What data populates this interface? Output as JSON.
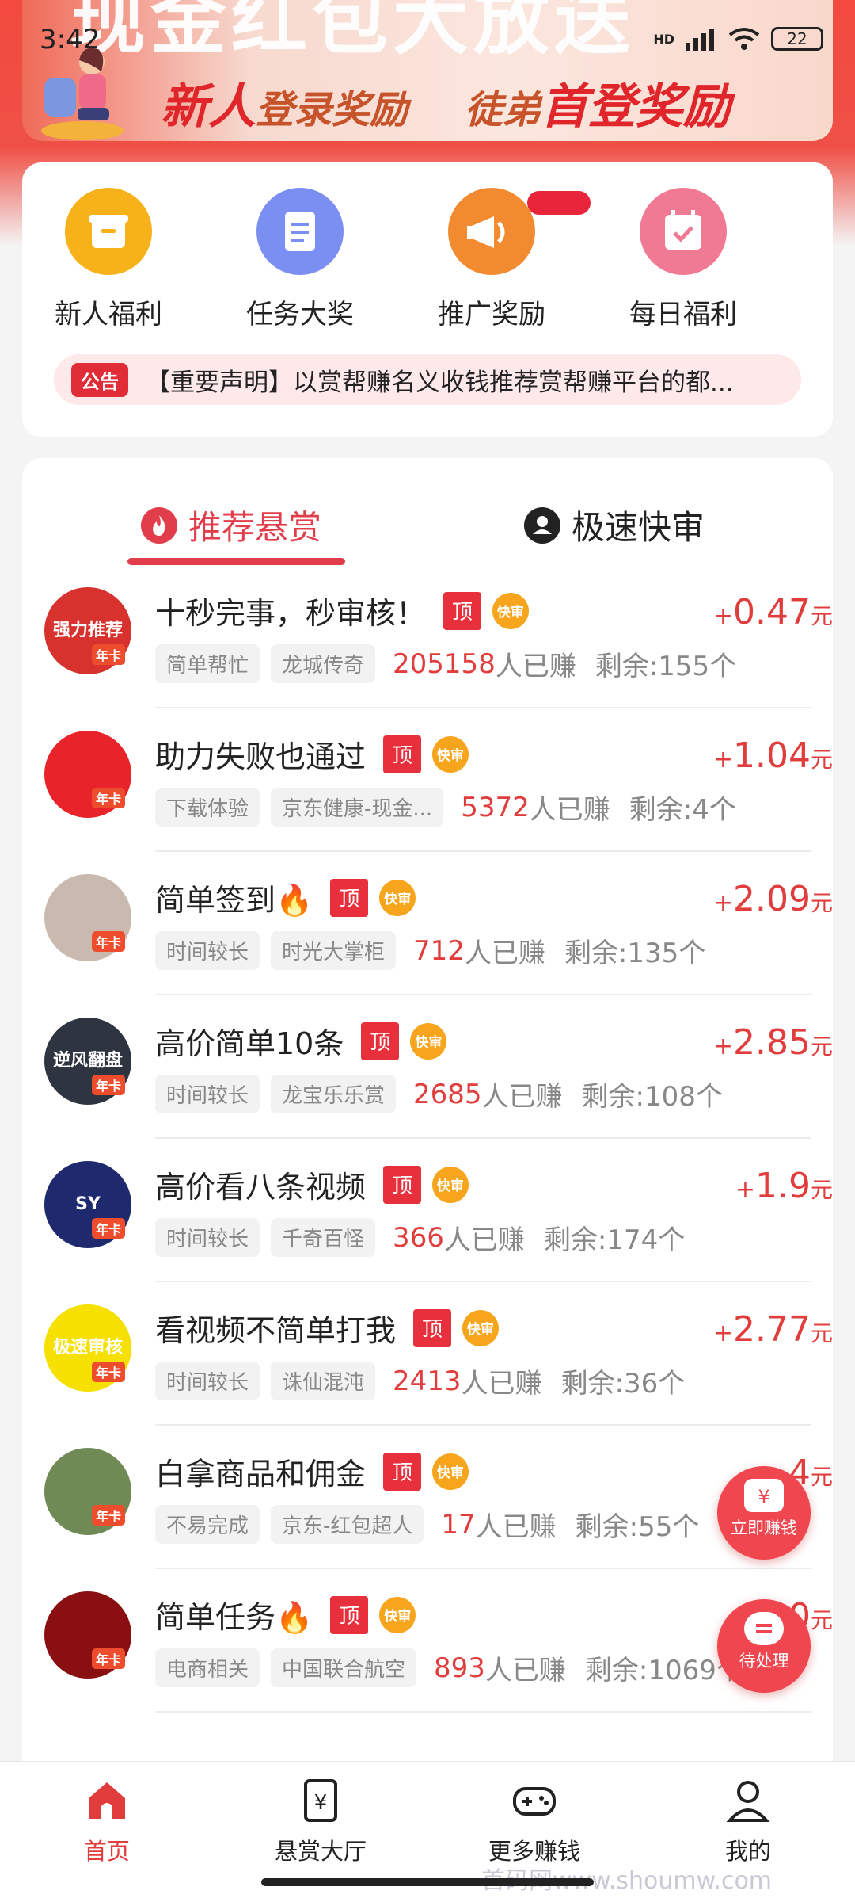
{
  "status_bar": {
    "time": "3:42",
    "network": "HD",
    "battery": "22"
  },
  "banner": {
    "headline": "现金红包大放送",
    "sub_part1": "新人",
    "sub_part2": "登录奖励",
    "sub_part3": "徒弟",
    "sub_part4": "首登奖励"
  },
  "quick_menu": [
    {
      "label": "新人福利",
      "icon": "gift-box-icon",
      "color": "#f7b21a"
    },
    {
      "label": "任务大奖",
      "icon": "clipboard-icon",
      "color": "#7b8ef2"
    },
    {
      "label": "推广奖励",
      "icon": "megaphone-icon",
      "color": "#f28a30"
    },
    {
      "label": "每日福利",
      "icon": "calendar-check-icon",
      "color": "#f07a93"
    }
  ],
  "notice": {
    "tag": "公告",
    "text": "【重要声明】以赏帮赚名义收钱推荐赏帮赚平台的都..."
  },
  "tabs": {
    "recommended": "推荐悬赏",
    "fast_review": "极速快审"
  },
  "badges": {
    "top": "顶",
    "fast": "快审",
    "annual_card": "年卡"
  },
  "labels": {
    "earned_suffix": "人已赚",
    "remaining_prefix": "剩余:",
    "remaining_suffix": "个",
    "plus": "+",
    "unit": "元"
  },
  "tasks": [
    {
      "title": "十秒完事，秒审核！",
      "price": "0.47",
      "chip1": "简单帮忙",
      "chip2": "龙城传奇",
      "earned": "205158",
      "remaining": "155",
      "avatar_color": "#d8322e",
      "avatar_text": "强力推荐"
    },
    {
      "title": "助力失败也通过",
      "price": "1.04",
      "chip1": "下载体验",
      "chip2": "京东健康-现金...",
      "earned": "5372",
      "remaining": "4",
      "avatar_color": "#e8242a",
      "avatar_text": ""
    },
    {
      "title": "简单签到🔥",
      "price": "2.09",
      "chip1": "时间较长",
      "chip2": "时光大掌柜",
      "earned": "712",
      "remaining": "135",
      "avatar_color": "#c9b9ae",
      "avatar_text": ""
    },
    {
      "title": "高价简单10条",
      "price": "2.85",
      "chip1": "时间较长",
      "chip2": "龙宝乐乐赏",
      "earned": "2685",
      "remaining": "108",
      "avatar_color": "#2e3440",
      "avatar_text": "逆风翻盘"
    },
    {
      "title": "高价看八条视频",
      "price": "1.9",
      "chip1": "时间较长",
      "chip2": "千奇百怪",
      "earned": "366",
      "remaining": "174",
      "avatar_color": "#1f2a6e",
      "avatar_text": "SY"
    },
    {
      "title": "看视频不简单打我",
      "price": "2.77",
      "chip1": "时间较长",
      "chip2": "诛仙混沌",
      "earned": "2413",
      "remaining": "36",
      "avatar_color": "#f5e000",
      "avatar_text": "极速审核"
    },
    {
      "title": "白拿商品和佣金",
      "price": "4",
      "chip1": "不易完成",
      "chip2": "京东-红包超人",
      "earned": "17",
      "remaining": "55",
      "avatar_color": "#6f8a55",
      "avatar_text": ""
    },
    {
      "title": "简单任务🔥",
      "price": "0",
      "chip1": "电商相关",
      "chip2": "中国联合航空",
      "earned": "893",
      "remaining": "1069",
      "avatar_color": "#8a0f12",
      "avatar_text": ""
    }
  ],
  "floating": {
    "earn_now": "立即赚钱",
    "pending": "待处理"
  },
  "bottom_nav": [
    {
      "label": "首页",
      "icon": "home-icon",
      "active": true
    },
    {
      "label": "悬赏大厅",
      "icon": "yuan-document-icon",
      "active": false
    },
    {
      "label": "更多赚钱",
      "icon": "gamepad-icon",
      "active": false
    },
    {
      "label": "我的",
      "icon": "user-icon",
      "active": false
    }
  ],
  "watermark": "首码网www.shoumw.com",
  "colors": {
    "accent": "#e23d3d",
    "header_red": "#f24a3f"
  }
}
